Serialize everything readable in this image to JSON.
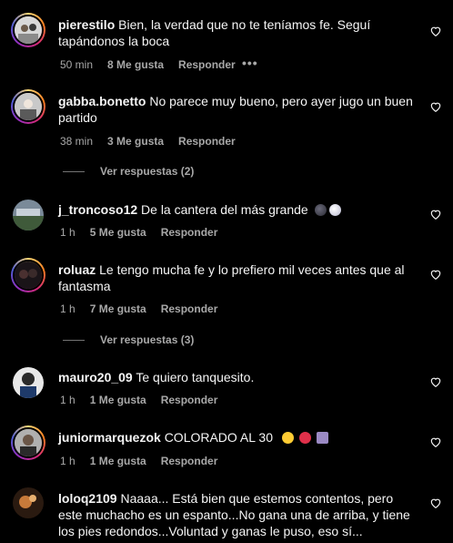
{
  "comments": [
    {
      "username": "pierestilo",
      "text": "Bien, la verdad que no te teníamos fe. Seguí tapándonos la boca",
      "time": "50 min",
      "likes": "8 Me gusta",
      "reply": "Responder",
      "more": "•••",
      "story_ring": true
    },
    {
      "username": "gabba.bonetto",
      "text": "No parece muy bueno, pero ayer jugo un buen partido",
      "time": "38 min",
      "likes": "3 Me gusta",
      "reply": "Responder",
      "view_replies": "Ver respuestas (2)",
      "story_ring": true
    },
    {
      "username": "j_troncoso12",
      "text": "De la cantera del más grande",
      "emojis": [
        "dark-moon-emoji",
        "light-moon-emoji"
      ],
      "time": "1 h",
      "likes": "5 Me gusta",
      "reply": "Responder",
      "story_ring": false
    },
    {
      "username": "roluaz",
      "text": "Le tengo mucha fe y lo prefiero mil veces antes que al fantasma",
      "time": "1 h",
      "likes": "7 Me gusta",
      "reply": "Responder",
      "view_replies": "Ver respuestas (3)",
      "story_ring": true
    },
    {
      "username": "mauro20_09",
      "text": "Te quiero tanquesito.",
      "time": "1 h",
      "likes": "1 Me gusta",
      "reply": "Responder",
      "story_ring": false
    },
    {
      "username": "juniormarquezok",
      "text": "COLORADO AL 30",
      "emojis": [
        "star-struck-emoji",
        "red-circle-emoji",
        "calendar-emoji"
      ],
      "time": "1 h",
      "likes": "1 Me gusta",
      "reply": "Responder",
      "story_ring": true
    },
    {
      "username": "loloq2109",
      "text": "Naaaa... Está bien que estemos contentos, pero este muchacho es un espanto...No gana una de arriba, y tiene los pies redondos...Voluntad y ganas le puso, eso sí...",
      "story_ring": false
    }
  ],
  "colors": {
    "background": "#000000",
    "text": "#f5f5f5",
    "secondary": "#a8a8a8"
  }
}
